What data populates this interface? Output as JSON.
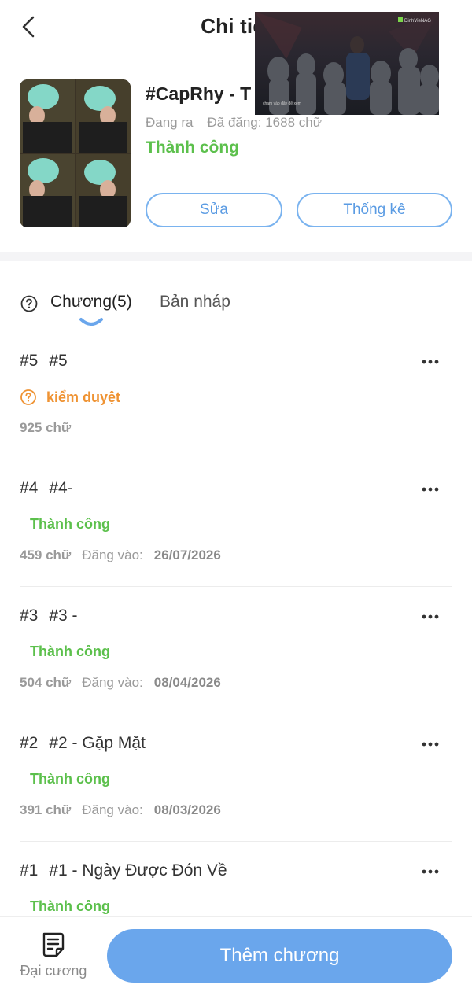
{
  "header": {
    "title": "Chi tiết",
    "back_icon": "chevron-left-icon"
  },
  "video_overlay": {
    "badge": "DinhVieNAG",
    "caption": "chạm vào đây để xem"
  },
  "story": {
    "title": "#CapRhy - T",
    "state": "Đang ra",
    "posted": "Đã đăng: 1688 chữ",
    "status": "Thành công",
    "edit_label": "Sửa",
    "stats_label": "Thống kê"
  },
  "tabs": {
    "help_icon": "help-circle-icon",
    "chapters": "Chương(5)",
    "drafts": "Bản nháp"
  },
  "chapters": [
    {
      "num": "#5",
      "title": "#5",
      "status": "kiểm duyệt",
      "status_type": "pending",
      "words": "925 chữ",
      "posted_label": "",
      "date": ""
    },
    {
      "num": "#4",
      "title": "#4-",
      "status": "Thành công",
      "status_type": "success",
      "words": "459 chữ",
      "posted_label": "Đăng vào:",
      "date": "26/07/2026"
    },
    {
      "num": "#3",
      "title": "#3 -",
      "status": "Thành công",
      "status_type": "success",
      "words": "504 chữ",
      "posted_label": "Đăng vào:",
      "date": "08/04/2026"
    },
    {
      "num": "#2",
      "title": "#2 - Gặp Mặt",
      "status": "Thành công",
      "status_type": "success",
      "words": "391 chữ",
      "posted_label": "Đăng vào:",
      "date": "08/03/2026"
    },
    {
      "num": "#1",
      "title": "#1 - Ngày Được Đón Về",
      "status": "Thành công",
      "status_type": "success",
      "words": "",
      "posted_label": "",
      "date": ""
    }
  ],
  "bottom": {
    "outline_label": "Đại cương",
    "add_chapter_label": "Thêm chương"
  },
  "colors": {
    "accent_blue": "#6aa6ec",
    "success_green": "#5cc04c",
    "pending_orange": "#ef9333"
  }
}
